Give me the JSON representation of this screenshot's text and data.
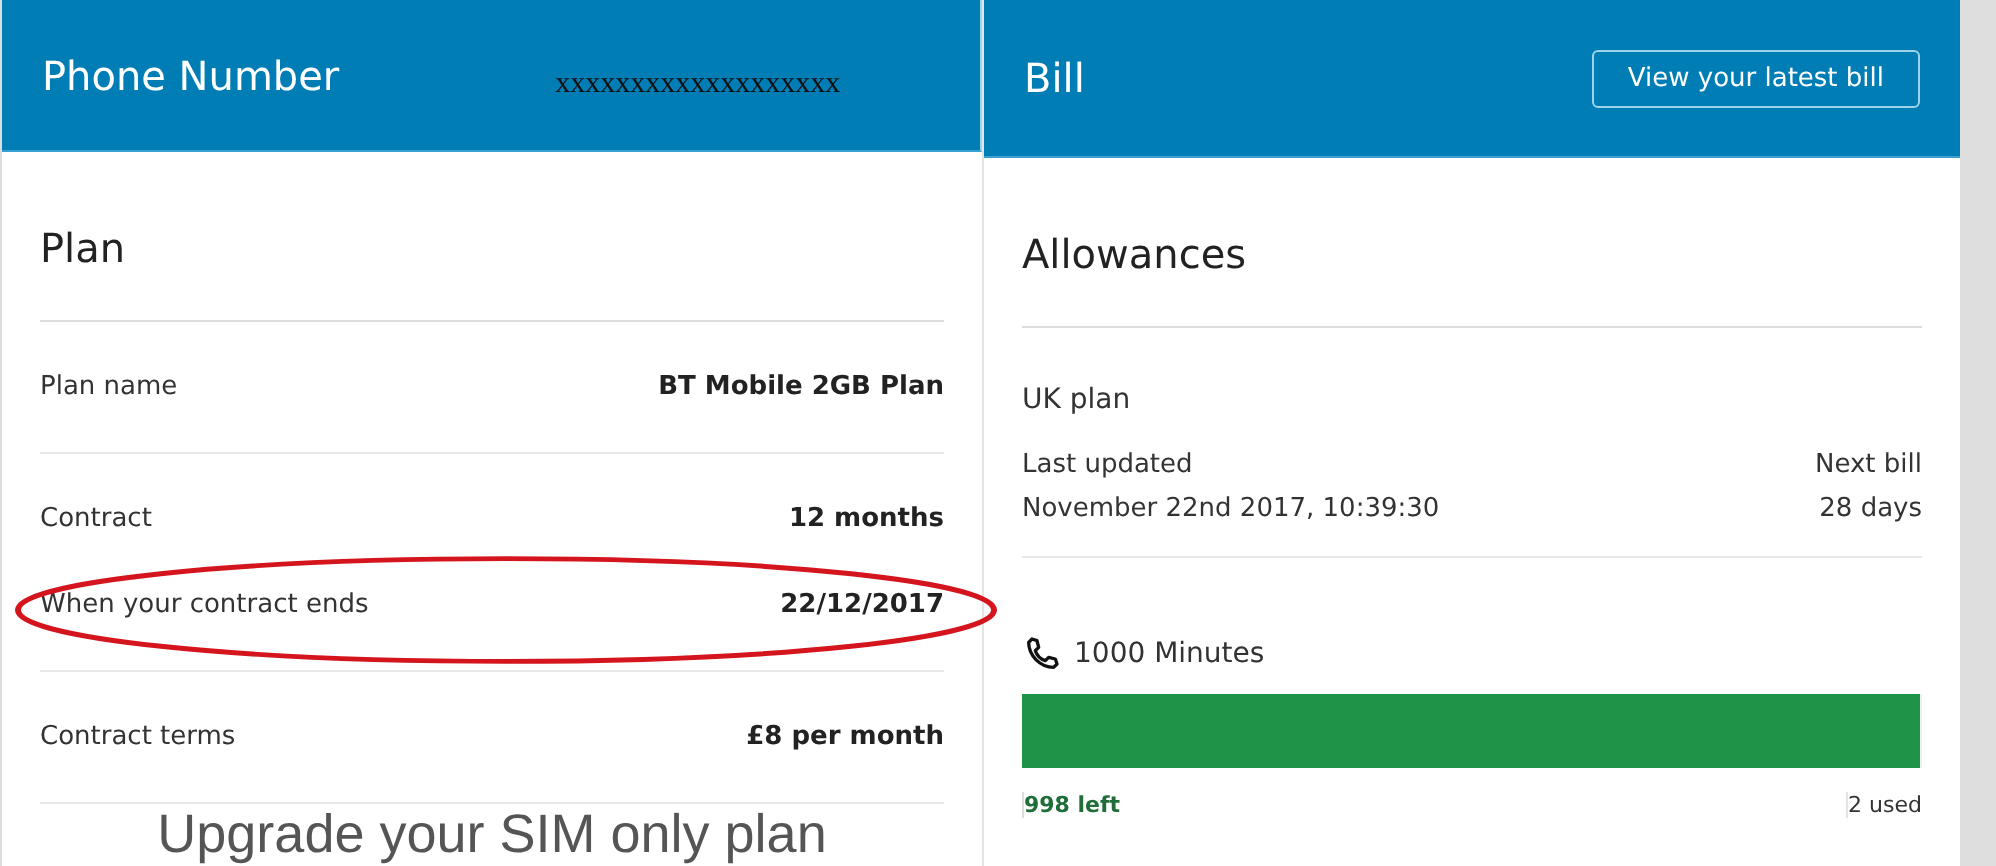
{
  "phone_panel": {
    "title": "Phone Number",
    "number": "xxxxxxxxxxxxxxxxxxx"
  },
  "bill_panel": {
    "title": "Bill",
    "button": "View your latest bill"
  },
  "plan": {
    "title": "Plan",
    "rows": [
      {
        "label": "Plan name",
        "value": "BT Mobile 2GB Plan",
        "circled": false
      },
      {
        "label": "Contract",
        "value": "12 months",
        "circled": false
      },
      {
        "label": "When your contract ends",
        "value": "22/12/2017",
        "circled": true
      },
      {
        "label": "Contract terms",
        "value": "£8 per month",
        "circled": false
      }
    ],
    "upgrade_heading": "Upgrade your SIM only plan"
  },
  "allowances": {
    "title": "Allowances",
    "plan_name": "UK plan",
    "last_updated_label": "Last updated",
    "last_updated": "November 22nd 2017, 10:39:30",
    "next_bill_label": "Next bill",
    "next_bill": "28 days",
    "items": [
      {
        "name": "1000 Minutes",
        "level": 0.998,
        "left": "998 left",
        "used": "2 used"
      }
    ]
  }
}
